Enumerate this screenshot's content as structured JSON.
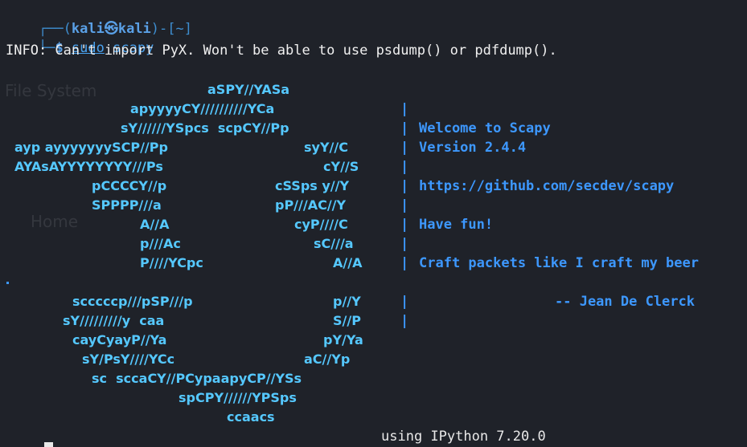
{
  "background_labels": {
    "filesystem": "File System",
    "home": "Home"
  },
  "prompt": {
    "user_host_prefix": "┌──(",
    "user_host": "kali㉿kali",
    "path_part": ")-[~]",
    "cmd_prefix": "└─",
    "dollar": "$",
    "cmd_sudo": "sudo",
    "cmd_scapy": " scapy"
  },
  "info_line": "INFO: Can't import PyX. Won't be able to use psdump() or pdfdump().",
  "ascii_art": [
    "aSPY//YASa",
    "apyyyyCY//////////YCa",
    "sY//////YSpcs  scpCY//Pp",
    "ayp ayyyyyyySCP//Pp",
    "syY//C",
    "AYAsAYYYYYYYY///Ps",
    "cY//S",
    "pCCCCY//p",
    "cSSps y//Y",
    "SPPPP///a",
    "pP///AC//Y",
    "A//A",
    "cyP////C",
    "p///Ac",
    "sC///a",
    "P////YCpc",
    "A//A",
    "scccccp///pSP///p",
    "p//Y",
    "sY/////////y  caa",
    "S//P",
    "cayCyayP//Ya",
    "pY/Ya",
    "sY/PsY////YCc",
    "aC//Yp",
    "sc  sccaCY//PCypaapyCP//YSs",
    "spCPY//////YPSps",
    "ccaacs"
  ],
  "welcome": {
    "line1": "Welcome to Scapy",
    "line2": "Version 2.4.4",
    "url": "https://github.com/secdev/scapy",
    "fun": "Have fun!",
    "quote": "Craft packets like I craft my beer",
    "author": "-- Jean De Clerck"
  },
  "separator": "|",
  "footer": "using IPython 7.20.0"
}
